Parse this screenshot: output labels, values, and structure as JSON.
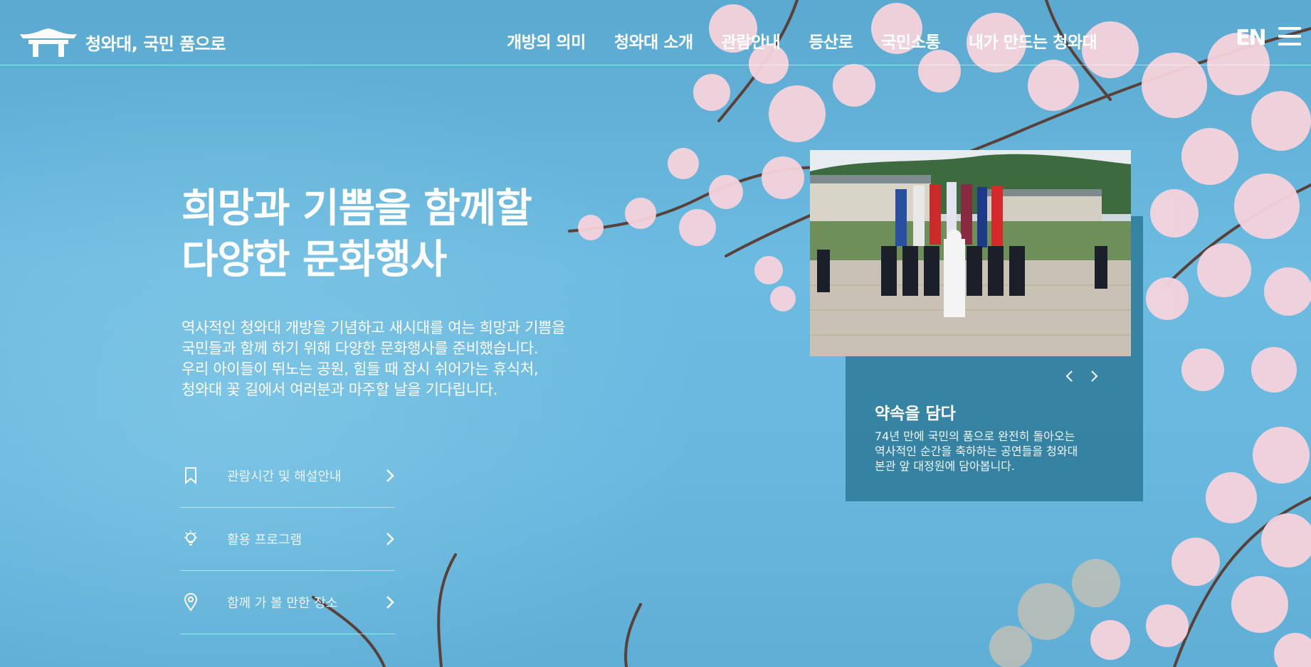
{
  "header": {
    "logo_text": "청와대, 국민 품으로",
    "nav": [
      "개방의 의미",
      "청와대 소개",
      "관람안내",
      "등산로",
      "국민소통",
      "내가 만드는 청와대"
    ],
    "lang": "EN",
    "menu_icon": "hamburger-icon"
  },
  "hero": {
    "title_lines": [
      "희망과 기쁨을 함께할",
      "다양한 문화행사"
    ],
    "desc_lines": [
      "역사적인 청와대 개방을 기념하고 새시대를 여는 희망과 기쁨을",
      "국민들과 함께 하기 위해 다양한 문화행사를 준비했습니다.",
      "우리 아이들이 뛰노는 공원, 힘들 때 잠시 쉬어가는 휴식처,",
      "청와대 꽃 길에서 여러분과 마주할 날을 기다립니다."
    ]
  },
  "quick_links": [
    {
      "label": "관람시간 및 해설안내",
      "icon": "bookmark-icon"
    },
    {
      "label": "활용 프로그램",
      "icon": "lightbulb-icon"
    },
    {
      "label": "함께 가 볼 만한 장소",
      "icon": "map-pin-icon"
    }
  ],
  "card": {
    "title": "약속을 담다",
    "desc_lines": [
      "74년 만에 국민의 품으로 완전히 돌아오는",
      "역사적인 순간을 축하하는 공연들을 청와대",
      "본관 앞 대정원에 담아봅니다."
    ]
  },
  "colors": {
    "sky": "#68b8de",
    "card_bg": "#236e8c",
    "blossom": "#f6d3dc"
  }
}
